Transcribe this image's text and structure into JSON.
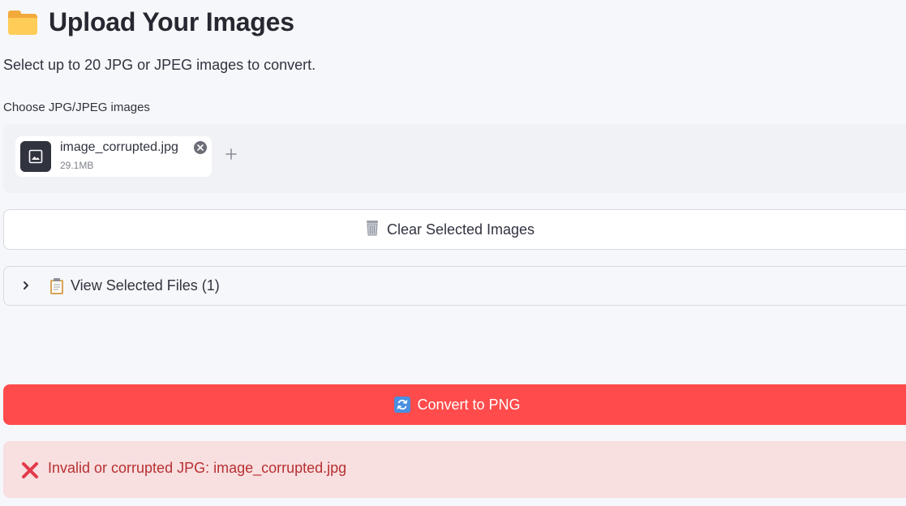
{
  "header": {
    "title": "Upload Your Images",
    "icon": "folder-icon"
  },
  "subtitle": "Select up to 20 JPG or JPEG images to convert.",
  "uploader": {
    "label": "Choose JPG/JPEG images",
    "files": [
      {
        "name": "image_corrupted.jpg",
        "size": "29.1MB",
        "icon": "image-file-icon"
      }
    ]
  },
  "buttons": {
    "clear_label": "Clear Selected Images",
    "convert_label": "Convert to PNG"
  },
  "expander": {
    "label": "View Selected Files (1)"
  },
  "error": {
    "message": "Invalid or corrupted JPG: image_corrupted.jpg"
  },
  "colors": {
    "primary": "#ff4b4b",
    "error_bg": "#f8dfe0",
    "error_text": "#b83032",
    "background": "#f6f7fa"
  }
}
